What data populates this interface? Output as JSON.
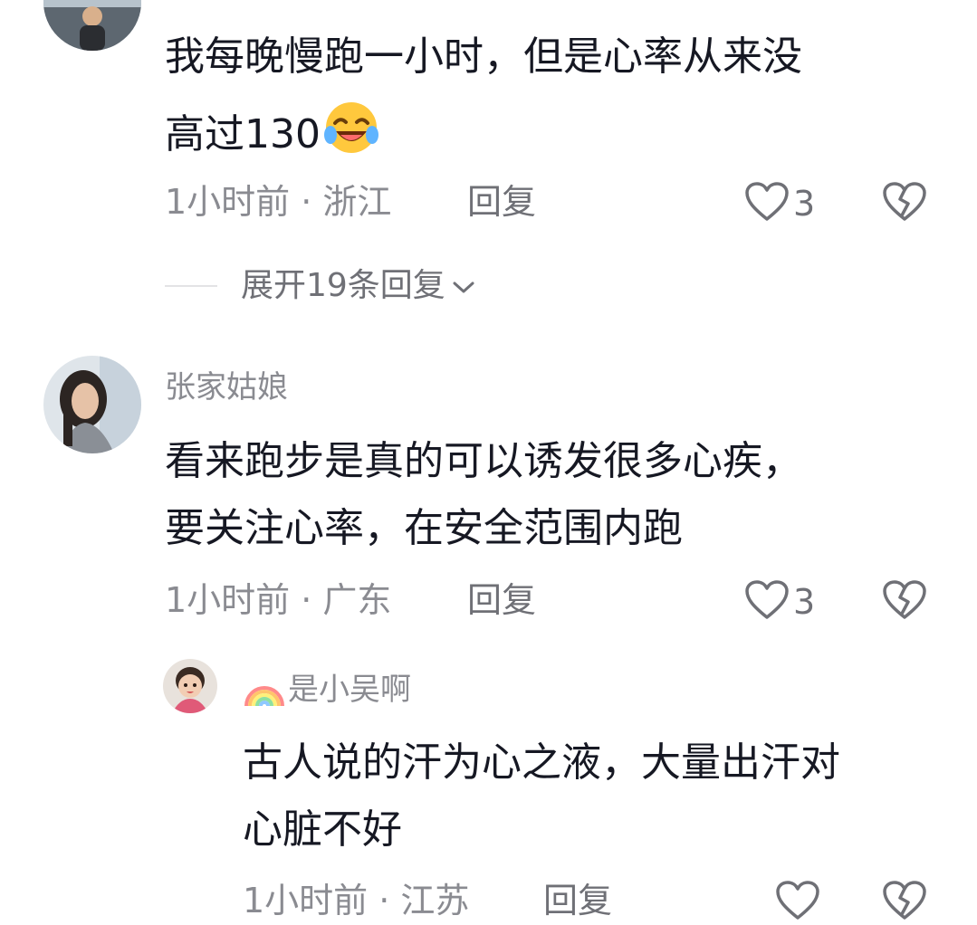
{
  "comments": [
    {
      "author": "",
      "text_lines": [
        "我每晚慢跑一小时，但是心率从来没",
        "高过130"
      ],
      "emoji_icon": "laughing-crying-emoji",
      "meta": "1小时前 · 浙江",
      "reply_label": "回复",
      "likes": "3",
      "expand_replies": "展开19条回复"
    },
    {
      "author": "张家姑娘",
      "text_lines": [
        "看来跑步是真的可以诱发很多心疾，",
        "要关注心率，在安全范围内跑"
      ],
      "meta": "1小时前 · 广东",
      "reply_label": "回复",
      "likes": "3",
      "reply": {
        "author_badge_icon": "rainbow-icon",
        "author": "是小吴啊",
        "text_lines": [
          "古人说的汗为心之液，大量出汗对",
          "心脏不好"
        ],
        "meta": "1小时前 · 江苏",
        "reply_label": "回复"
      }
    }
  ],
  "icons": {
    "like": "heart-outline-icon",
    "dislike": "broken-heart-icon",
    "expand": "chevron-down-icon"
  },
  "colors": {
    "text": "#161823",
    "secondary": "#8a8b91",
    "action": "#6f7076",
    "divider": "#e3e3e5"
  }
}
